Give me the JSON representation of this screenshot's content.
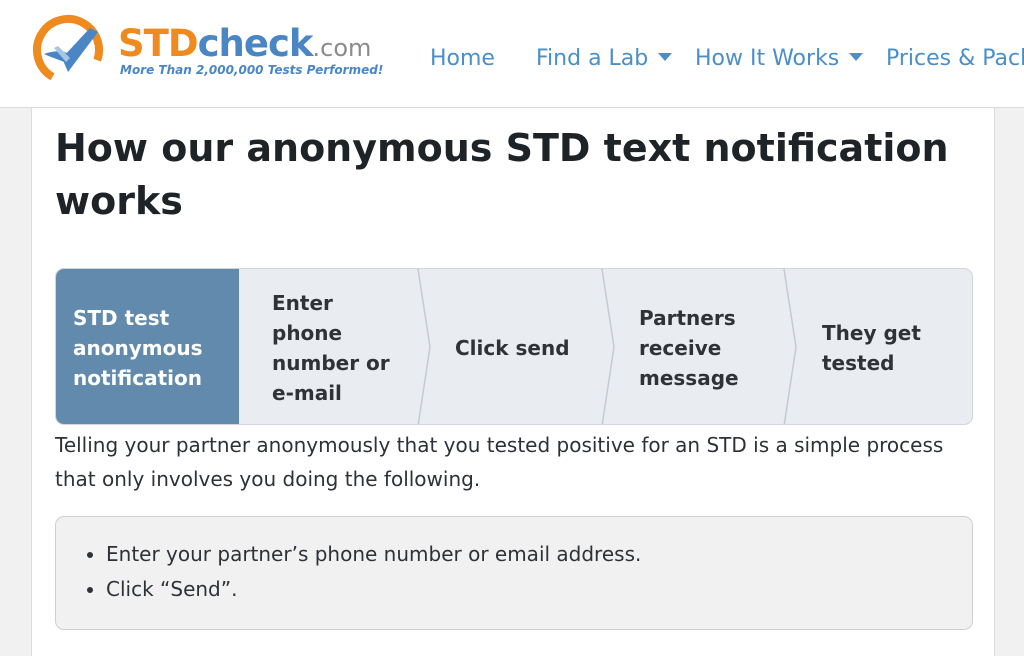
{
  "header": {
    "logo": {
      "part1": "STD",
      "part2": "check",
      "part3": ".com",
      "tagline": "More Than 2,000,000 Tests Performed!",
      "colors": {
        "orange": "#ef8a1f",
        "blue": "#4b86c4",
        "gray": "#8b8b8b"
      }
    },
    "nav": [
      {
        "label": "Home",
        "dropdown": false
      },
      {
        "label": "Find a Lab",
        "dropdown": true
      },
      {
        "label": "How It Works",
        "dropdown": true
      },
      {
        "label": "Prices & Packa",
        "dropdown": false
      }
    ]
  },
  "main": {
    "title": "How our anonymous STD text notification works",
    "steps": [
      {
        "lines": [
          "STD test",
          "anonymous",
          "notification"
        ],
        "active": true
      },
      {
        "lines": [
          "Enter",
          "phone",
          "number or",
          "e-mail"
        ],
        "active": false
      },
      {
        "lines": [
          "Click send"
        ],
        "active": false
      },
      {
        "lines": [
          "Partners",
          "receive",
          "message"
        ],
        "active": false
      },
      {
        "lines": [
          "They get",
          "tested"
        ],
        "active": false
      }
    ],
    "paragraph": "Telling your partner anonymously that you tested positive for an STD is a simple process that only involves you doing the following.",
    "list": [
      "Enter your partner’s phone number or email address.",
      "Click “Send”."
    ]
  },
  "colors": {
    "active_step": "#628aad",
    "step_bg": "#e9edf1",
    "link": "#4a8fc9"
  }
}
